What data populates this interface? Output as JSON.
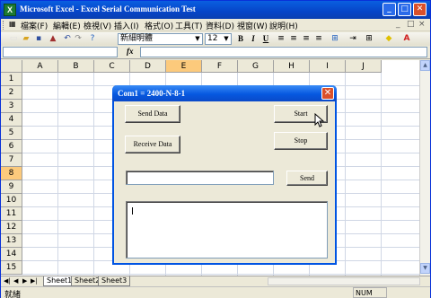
{
  "window": {
    "title": "Microsoft Excel - Excel Serial Communication Test",
    "icon_label": "X"
  },
  "title_buttons": {
    "minimize": "_",
    "restore": "□",
    "close": "✕"
  },
  "menu": {
    "items": [
      "檔案(F)",
      "編輯(E)",
      "檢視(V)",
      "插入(I)",
      "格式(O)",
      "工具(T)",
      "資料(D)",
      "視窗(W)",
      "說明(H)"
    ]
  },
  "toolbar": {
    "font_name": "新細明體",
    "font_size": "12",
    "bold": "B",
    "italic": "I",
    "underline": "U"
  },
  "formula_bar": {
    "fx": "fx",
    "name_box": "",
    "formula": ""
  },
  "sheet": {
    "columns": [
      "A",
      "B",
      "C",
      "D",
      "E",
      "F",
      "G",
      "H",
      "I",
      "J"
    ],
    "selected_column": "E",
    "rows": [
      "1",
      "2",
      "3",
      "4",
      "5",
      "6",
      "7",
      "8",
      "9",
      "10",
      "11",
      "12",
      "13",
      "14",
      "15"
    ],
    "selected_row": "8"
  },
  "sheet_tabs": [
    "Sheet1",
    "Sheet2",
    "Sheet3"
  ],
  "active_sheet": "Sheet1",
  "status": {
    "ready": "就緒",
    "num": "NUM"
  },
  "dialog": {
    "title": "Com1 = 2400-N-8-1",
    "close": "✕",
    "send_data_label": "Send Data",
    "start_label": "Start",
    "receive_data_label": "Receive Data",
    "stop_label": "Stop",
    "send_label": "Send",
    "send_text": "",
    "receive_text": ""
  },
  "colors": {
    "title_bar": "#0a5fe0",
    "selection_header": "#fcca7c",
    "close_button": "#d9502b"
  }
}
